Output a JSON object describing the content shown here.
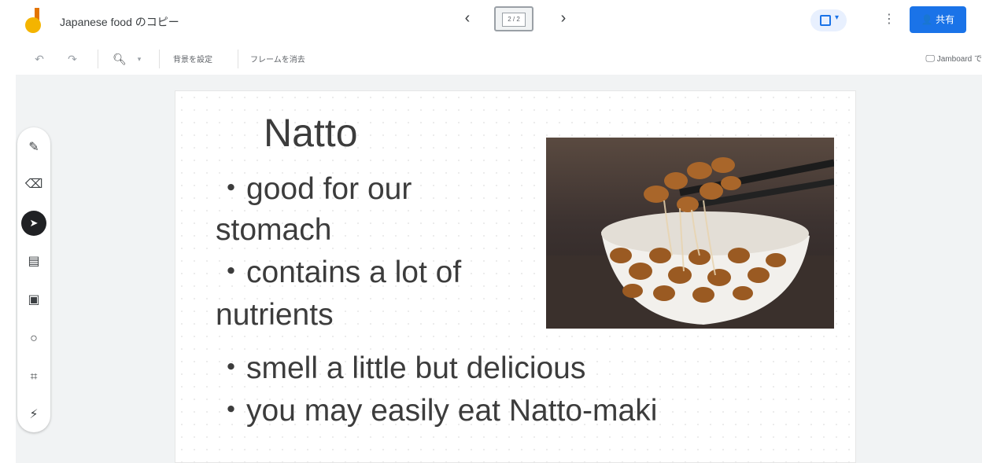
{
  "header": {
    "doc_title": "Japanese food のコピー",
    "frame_indicator": "2 / 2",
    "share_label": "共有",
    "more_glyph": "⋮",
    "prev_glyph": "‹",
    "next_glyph": "›"
  },
  "toolbar": {
    "set_background_label": "背景を設定",
    "clear_frame_label": "フレームを消去",
    "jamboard_label": "Jamboard で"
  },
  "tools": [
    {
      "name": "pen-icon",
      "glyph": "✎"
    },
    {
      "name": "eraser-icon",
      "glyph": "⌫"
    },
    {
      "name": "select-icon",
      "glyph": "➤"
    },
    {
      "name": "sticky-note-icon",
      "glyph": "▤"
    },
    {
      "name": "image-icon",
      "glyph": "▣"
    },
    {
      "name": "circle-icon",
      "glyph": "○"
    },
    {
      "name": "text-box-icon",
      "glyph": "⌗"
    },
    {
      "name": "laser-icon",
      "glyph": "⚡"
    }
  ],
  "slide": {
    "title": "Natto",
    "bullets_left": [
      "・good for our",
      "stomach",
      "・contains a lot of",
      "nutrients"
    ],
    "bullets_bottom": [
      "・smell a little but delicious",
      "・you may easily eat Natto-maki"
    ]
  },
  "colors": {
    "accent": "#1a73e8",
    "logo_yellow": "#f4b400",
    "text": "#3c3c3c"
  }
}
